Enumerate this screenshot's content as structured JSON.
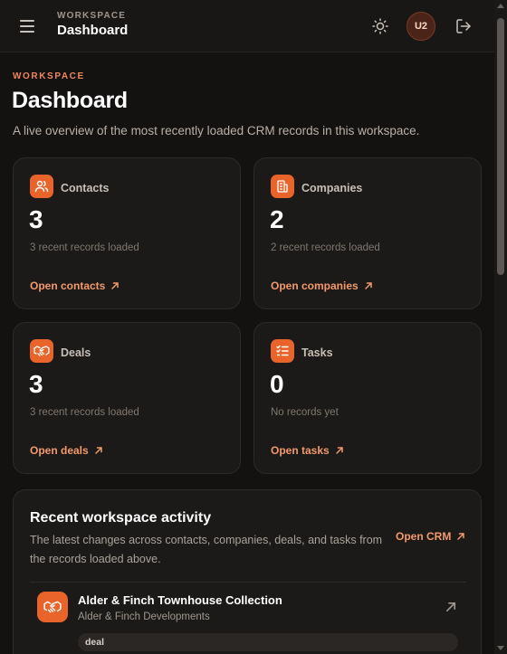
{
  "header": {
    "eyebrow": "WORKSPACE",
    "title": "Dashboard",
    "avatar_initials": "U2",
    "icons": {
      "menu": "hamburger-icon",
      "theme": "sun-icon",
      "logout": "logout-icon"
    }
  },
  "page": {
    "eyebrow": "WORKSPACE",
    "title": "Dashboard",
    "description": "A live overview of the most recently loaded CRM records in this workspace."
  },
  "cards": [
    {
      "label": "Contacts",
      "count": "3",
      "sub": "3 recent records loaded",
      "link": "Open contacts",
      "icon": "users-icon"
    },
    {
      "label": "Companies",
      "count": "2",
      "sub": "2 recent records loaded",
      "link": "Open companies",
      "icon": "building-icon"
    },
    {
      "label": "Deals",
      "count": "3",
      "sub": "3 recent records loaded",
      "link": "Open deals",
      "icon": "handshake-icon"
    },
    {
      "label": "Tasks",
      "count": "0",
      "sub": "No records yet",
      "link": "Open tasks",
      "icon": "task-list-icon"
    }
  ],
  "activity": {
    "title": "Recent workspace activity",
    "description": "The latest changes across contacts, companies, deals, and tasks from the records loaded above.",
    "open_link": "Open CRM",
    "items": [
      {
        "title": "Alder & Finch Townhouse Collection",
        "subtitle": "Alder & Finch Developments",
        "badge": "deal",
        "icon": "handshake-icon"
      }
    ]
  },
  "colors": {
    "accent": "#e8642a",
    "link": "#f29a6b",
    "background": "#141211",
    "card": "#1c1a18"
  }
}
